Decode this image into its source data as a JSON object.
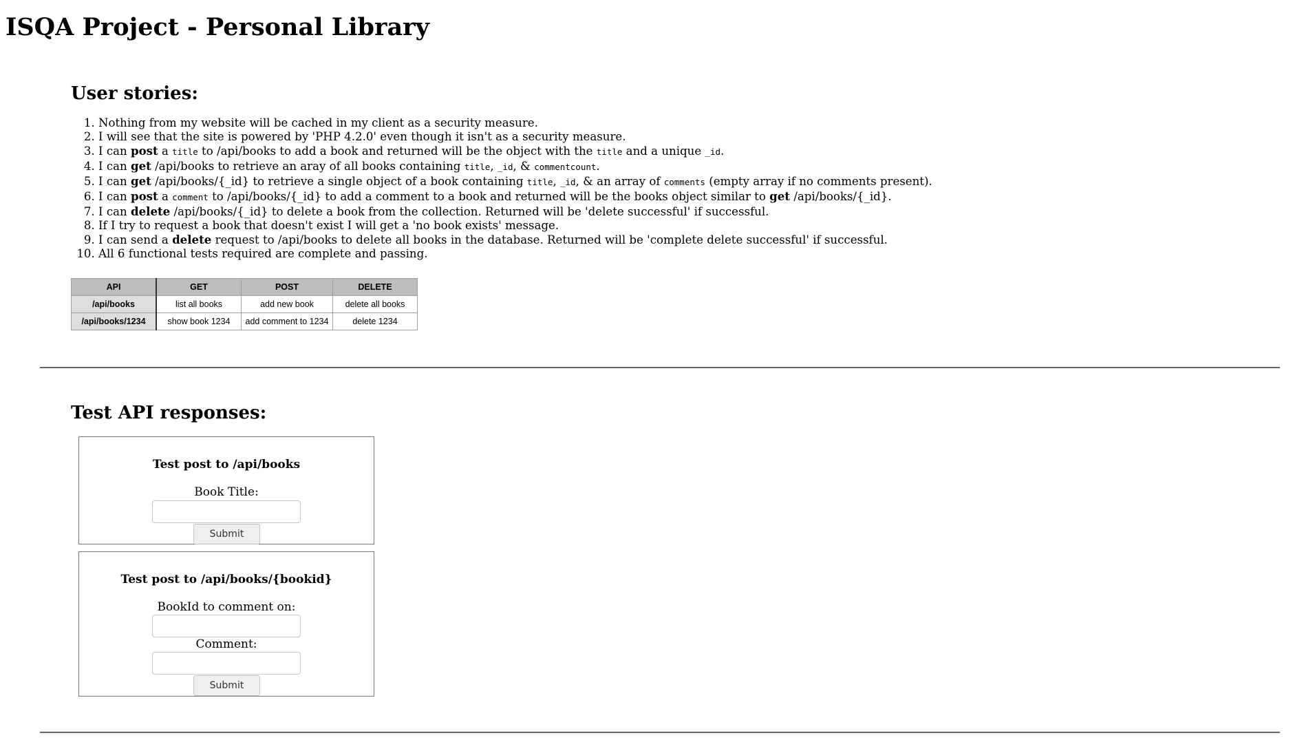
{
  "page": {
    "title": "ISQA Project - Personal Library"
  },
  "stories": {
    "heading": "User stories:",
    "items": [
      [
        {
          "t": "Nothing from my website will be cached in my client as a security measure."
        }
      ],
      [
        {
          "t": "I will see that the site is powered by 'PHP 4.2.0' even though it isn't as a security measure."
        }
      ],
      [
        {
          "t": "I can "
        },
        {
          "b": "post"
        },
        {
          "t": " a "
        },
        {
          "c": "title"
        },
        {
          "t": " to /api/books to add a book and returned will be the object with the "
        },
        {
          "c": "title"
        },
        {
          "t": " and a unique "
        },
        {
          "c": "_id"
        },
        {
          "t": "."
        }
      ],
      [
        {
          "t": "I can "
        },
        {
          "b": "get"
        },
        {
          "t": " /api/books to retrieve an aray of all books containing "
        },
        {
          "c": "title"
        },
        {
          "t": ", "
        },
        {
          "c": "_id"
        },
        {
          "t": ", & "
        },
        {
          "c": "commentcount"
        },
        {
          "t": "."
        }
      ],
      [
        {
          "t": "I can "
        },
        {
          "b": "get"
        },
        {
          "t": " /api/books/{_id} to retrieve a single object of a book containing "
        },
        {
          "c": "title"
        },
        {
          "t": ", "
        },
        {
          "c": "_id"
        },
        {
          "t": ", & an array of "
        },
        {
          "c": "comments"
        },
        {
          "t": " (empty array if no comments present)."
        }
      ],
      [
        {
          "t": "I can "
        },
        {
          "b": "post"
        },
        {
          "t": " a "
        },
        {
          "c": "comment"
        },
        {
          "t": " to /api/books/{_id} to add a comment to a book and returned will be the books object similar to "
        },
        {
          "b": "get"
        },
        {
          "t": " /api/books/{_id}."
        }
      ],
      [
        {
          "t": "I can "
        },
        {
          "b": "delete"
        },
        {
          "t": " /api/books/{_id} to delete a book from the collection. Returned will be 'delete successful' if successful."
        }
      ],
      [
        {
          "t": "If I try to request a book that doesn't exist I will get a 'no book exists' message."
        }
      ],
      [
        {
          "t": "I can send a "
        },
        {
          "b": "delete"
        },
        {
          "t": " request to /api/books to delete all books in the database. Returned will be 'complete delete successful' if successful."
        }
      ],
      [
        {
          "t": "All 6 functional tests required are complete and passing."
        }
      ]
    ]
  },
  "api_table": {
    "headers": [
      "API",
      "GET",
      "POST",
      "DELETE"
    ],
    "rows": [
      [
        "/api/books",
        "list all books",
        "add new book",
        "delete all books"
      ],
      [
        "/api/books/1234",
        "show book 1234",
        "add comment to 1234",
        "delete 1234"
      ]
    ]
  },
  "tests": {
    "heading": "Test API responses:",
    "form_books": {
      "title": "Test post to /api/books",
      "label": "Book Title:",
      "input_value": "",
      "submit_label": "Submit"
    },
    "form_comment": {
      "title": "Test post to /api/books/{bookid}",
      "label_id": "BookId to comment on:",
      "id_value": "",
      "label_comment": "Comment:",
      "comment_value": "",
      "submit_label": "Submit"
    }
  }
}
